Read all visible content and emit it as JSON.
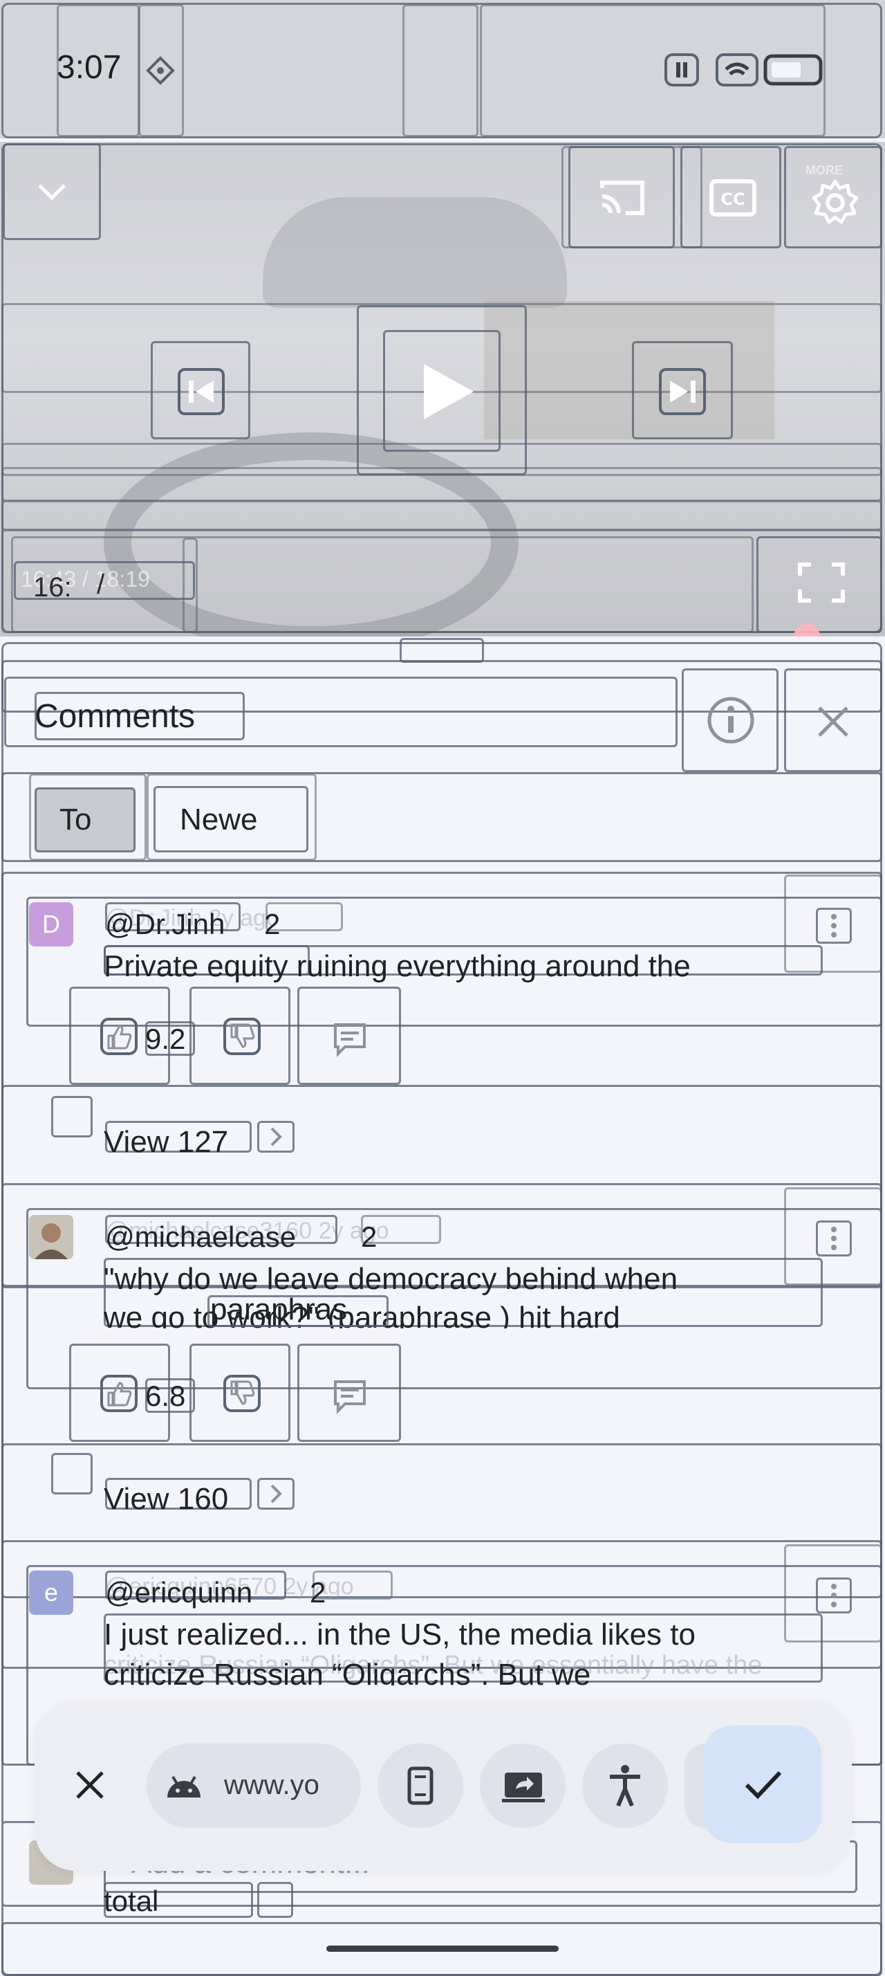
{
  "status_bar": {
    "time": "3:07"
  },
  "player": {
    "collapse": "chevron-down-icon",
    "top_controls": [
      "cast-icon",
      "closed-captions-icon",
      "settings-gear-icon"
    ],
    "settings_caption": "MORE",
    "elapsed_short": "16:",
    "separator": "/",
    "time_display": "16:43 / 18:19"
  },
  "comments_panel": {
    "title": "Comments",
    "sort_tabs": [
      {
        "label": "To",
        "selected": true
      },
      {
        "label": "Newe",
        "selected": false
      }
    ],
    "comments": [
      {
        "avatar_letter": "D",
        "avatar_color": "#c79ddd",
        "author": "@Dr.Jinh",
        "age_number": "2",
        "faded_meta": "@Dr.Jinh 2y ago",
        "text": "Private equity ruining everything around the",
        "likes": "9.2",
        "view_replies": "View 127"
      },
      {
        "avatar_letter": "",
        "avatar_color": "#b9a58f",
        "author": "@michaelcase",
        "age_number": "2",
        "faded_meta": "@michaelcase3160 2y ago",
        "text_line1": "\"why do we leave democracy behind when",
        "text_line2": "we go to work?\" (paraphrase ) hit hard",
        "link_label": "paraphras",
        "likes": "6.8",
        "view_replies": "View 160"
      },
      {
        "avatar_letter": "e",
        "avatar_color": "#9aa4d8",
        "author": "@ericquinn",
        "age_number": "2",
        "faded_meta": "@ericquinn6570 2y ago",
        "text_line1": "I just realized... in the US, the media likes to",
        "text_line2": "criticize Russian “Oligarchs”. But we",
        "faded_line2": "criticize Russian “Oligarchs”. But we essentially have the"
      }
    ],
    "add_comment_placeholder": "Add a comment...",
    "total_label": "total"
  },
  "select_toolbar": {
    "app_chip": "www.yo",
    "actions": [
      "close-icon",
      "android-icon",
      "phone-icon",
      "cast-screen-icon",
      "accessibility-icon",
      "check-icon"
    ]
  },
  "colors": {
    "background": "#f4f5fa",
    "status_bar": "#d3d5da",
    "overlay_border": "#596374",
    "fab": "#d4e3f7",
    "text": "#202226"
  }
}
